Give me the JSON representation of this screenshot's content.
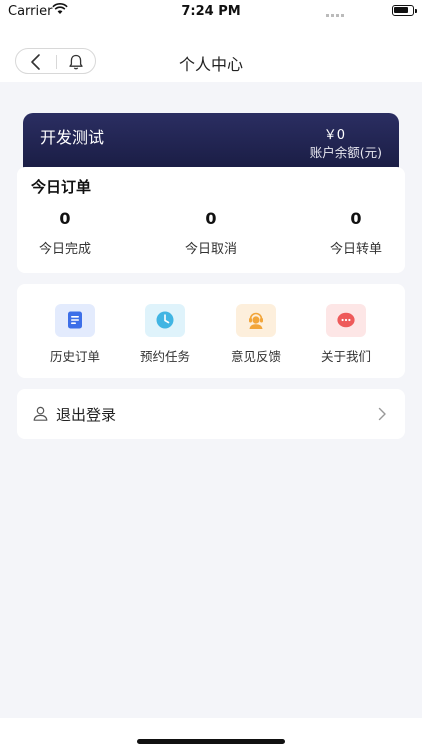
{
  "status_bar": {
    "carrier": "Carrier",
    "time": "7:24 PM"
  },
  "nav": {
    "title": "个人中心"
  },
  "profile": {
    "name": "开发测试",
    "balance": "￥0",
    "balance_label": "账户余额(元)"
  },
  "orders": {
    "title": "今日订单",
    "stats": [
      {
        "value": "0",
        "label": "今日完成"
      },
      {
        "value": "0",
        "label": "今日取消"
      },
      {
        "value": "0",
        "label": "今日转单"
      }
    ]
  },
  "menu": {
    "items": [
      {
        "label": "历史订单",
        "icon": "document-icon",
        "color": "#3d6fe8",
        "bg": "#e3ebfd"
      },
      {
        "label": "预约任务",
        "icon": "clock-icon",
        "color": "#41b5e3",
        "bg": "#dff3fb"
      },
      {
        "label": "意见反馈",
        "icon": "support-agent-icon",
        "color": "#f2a53a",
        "bg": "#fdefdc"
      },
      {
        "label": "关于我们",
        "icon": "chat-bubble-icon",
        "color": "#ee5a5a",
        "bg": "#fde6e6"
      }
    ]
  },
  "logout": {
    "label": "退出登录"
  }
}
